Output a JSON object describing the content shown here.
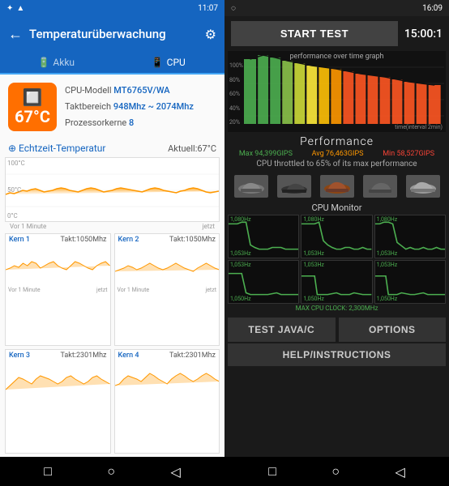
{
  "status_left": {
    "time": "11:07",
    "icons": [
      "bluetooth",
      "signal"
    ]
  },
  "status_right": {
    "battery": "16:09",
    "icons": [
      "wifi",
      "battery"
    ]
  },
  "left_panel": {
    "title": "Temperaturüberwachung",
    "tabs": [
      {
        "id": "akku",
        "label": "Akku",
        "icon": "🔋",
        "active": false
      },
      {
        "id": "cpu",
        "label": "CPU",
        "icon": "💻",
        "active": true
      }
    ],
    "cpu_info": {
      "temp": "67°C",
      "model_label": "CPU-Modell",
      "model_value": "MT6765V/WA",
      "takt_label": "Taktbereich",
      "takt_value": "948Mhz ~ 2074Mhz",
      "kerne_label": "Prozessorkerne",
      "kerne_value": "8"
    },
    "realtime": {
      "label": "⊕ Echtzeit-Temperatur",
      "aktuell": "Aktuell:67°C"
    },
    "chart_labels": {
      "top": "100°C",
      "mid": "50°C",
      "bot": "0°C",
      "x_left": "Vor 1 Minute",
      "x_right": "jetzt"
    },
    "cores": [
      {
        "name": "Kern 1",
        "freq": "Takt:1050Mhz",
        "x_left": "Vor 1 Minute",
        "x_right": "jetzt"
      },
      {
        "name": "Kern 2",
        "freq": "Takt:1050Mhz",
        "x_left": "Vor 1 Minute",
        "x_right": "jetzt"
      },
      {
        "name": "Kern 3",
        "freq": "Takt:2301Mhz",
        "x_left": "",
        "x_right": ""
      },
      {
        "name": "Kern 4",
        "freq": "Takt:2301Mhz",
        "x_left": "",
        "x_right": ""
      }
    ]
  },
  "right_panel": {
    "start_btn": "START TEST",
    "timer": "15:00:1",
    "graph_title": "performance over time graph",
    "graph_y": [
      "100%",
      "80%",
      "60%",
      "40%",
      "20%"
    ],
    "graph_x": "time(interval 2min)",
    "performance": {
      "title": "Performance",
      "max": "Max 94,399GIPS",
      "avg": "Avg 76,463GIPS",
      "min": "Min 58,527GIPS",
      "throttle": "CPU throttled to 65% of its max performance"
    },
    "cpu_monitor_title": "CPU Monitor",
    "monitor_freqs": {
      "top_row": [
        "1,080Hz",
        "1,080Hz",
        "1,080Hz"
      ],
      "bottom_row_top": [
        "1,053Hz",
        "1,053Hz",
        "1,053Hz"
      ],
      "bottom_row_bot": [
        "1,050Hz",
        "1,050Hz",
        "1,050Hz"
      ]
    },
    "max_cpu": "MAX CPU CLOCK: 2,300MHz",
    "buttons": {
      "test_java": "TEST JAVA/C",
      "options": "OPTIONS",
      "help": "HELP/INSTRUCTIONS"
    }
  },
  "nav": {
    "left_icons": [
      "□",
      "○",
      "◁"
    ],
    "right_icons": [
      "□",
      "○",
      "◁"
    ]
  }
}
